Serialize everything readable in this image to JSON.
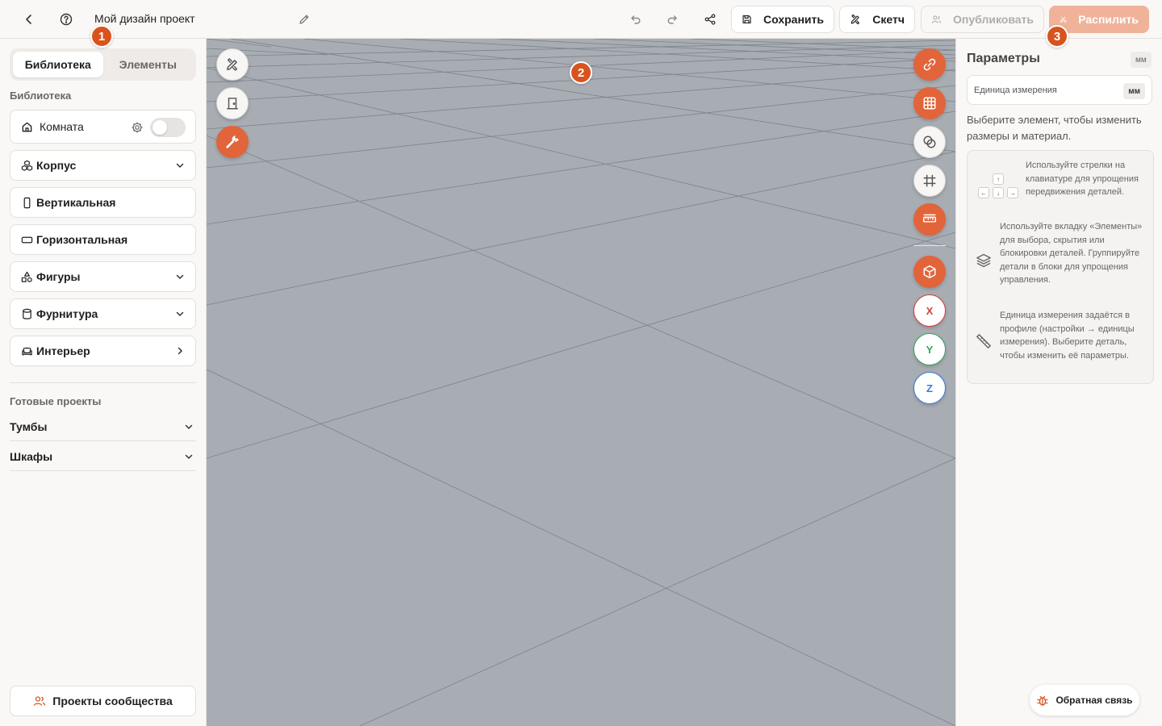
{
  "topbar": {
    "project_title": "Мой дизайн проект",
    "save_label": "Сохранить",
    "sketch_label": "Скетч",
    "publish_label": "Опубликовать",
    "cut_label": "Распилить"
  },
  "badges": {
    "one": "1",
    "two": "2",
    "three": "3"
  },
  "sidebar": {
    "tabs": [
      {
        "label": "Библиотека"
      },
      {
        "label": "Элементы"
      }
    ],
    "library_heading": "Библиотека",
    "items": [
      {
        "label": "Комната"
      },
      {
        "label": "Корпус"
      },
      {
        "label": "Вертикальная"
      },
      {
        "label": "Горизонтальная"
      },
      {
        "label": "Фигуры"
      },
      {
        "label": "Фурнитура"
      },
      {
        "label": "Интерьер"
      }
    ],
    "projects_heading": "Готовые проекты",
    "projects": [
      {
        "label": "Тумбы"
      },
      {
        "label": "Шкафы"
      }
    ],
    "community_label": "Проекты сообщества"
  },
  "canvas": {
    "axes": {
      "x": "X",
      "y": "Y",
      "z": "Z"
    },
    "axis_colors": {
      "x": "#d93b3b",
      "y": "#3aa45a",
      "z": "#3b78d9"
    },
    "accent": "#e2643a",
    "background": "#a8adb3"
  },
  "params": {
    "title": "Параметры",
    "unit_chip": "мм",
    "unit_field_label": "Единица измерения",
    "unit_field_value": "мм",
    "hint": "Выберите элемент, чтобы изменить размеры и материал.",
    "tips": [
      {
        "text": "Используйте стрелки на клавиатуре для упрощения передвижения деталей."
      },
      {
        "text": "Используйте вкладку «Элементы» для выбора, скрытия или блокировки деталей. Группируйте детали в блоки для упрощения управления."
      },
      {
        "text": "Единица измерения задаётся в профиле (настройки → единицы измерения). Выберите деталь, чтобы изменить её параметры."
      }
    ],
    "feedback_label": "Обратная связь"
  }
}
